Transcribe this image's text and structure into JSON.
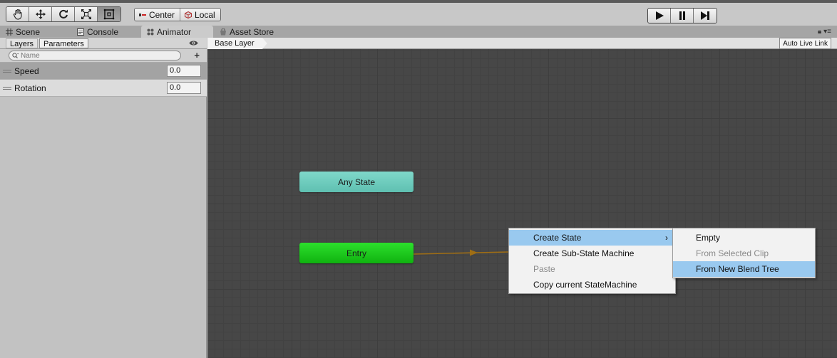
{
  "toolbar": {
    "tools": [
      "hand-tool",
      "move-tool",
      "rotate-tool",
      "scale-tool",
      "rect-tool"
    ],
    "pivot_mode_label": "Center",
    "pivot_rotation_label": "Local"
  },
  "tabs": {
    "scene": "Scene",
    "console": "Console",
    "animator": "Animator",
    "asset_store": "Asset Store"
  },
  "left_panel": {
    "tab_layers": "Layers",
    "tab_parameters": "Parameters",
    "search_placeholder": "Name",
    "parameters": [
      {
        "name": "Speed",
        "value": "0.0"
      },
      {
        "name": "Rotation",
        "value": "0.0"
      }
    ]
  },
  "graph": {
    "breadcrumb": "Base Layer",
    "auto_live_link": "Auto Live Link",
    "nodes": {
      "any_state": "Any State",
      "entry": "Entry"
    }
  },
  "context_menu": {
    "items": [
      {
        "label": "Create State",
        "state": "hover"
      },
      {
        "label": "Create Sub-State Machine",
        "state": "normal"
      },
      {
        "label": "Paste",
        "state": "disabled"
      },
      {
        "label": "Copy current StateMachine",
        "state": "normal"
      }
    ],
    "submenu": [
      {
        "label": "Empty",
        "state": "normal"
      },
      {
        "label": "From Selected Clip",
        "state": "disabled"
      },
      {
        "label": "From New Blend Tree",
        "state": "hover"
      }
    ]
  },
  "colors": {
    "any_state_node": "#6ccdbf",
    "entry_node": "#1fc91f",
    "transition": "#a06e14",
    "menu_hover": "#99c9ef"
  }
}
